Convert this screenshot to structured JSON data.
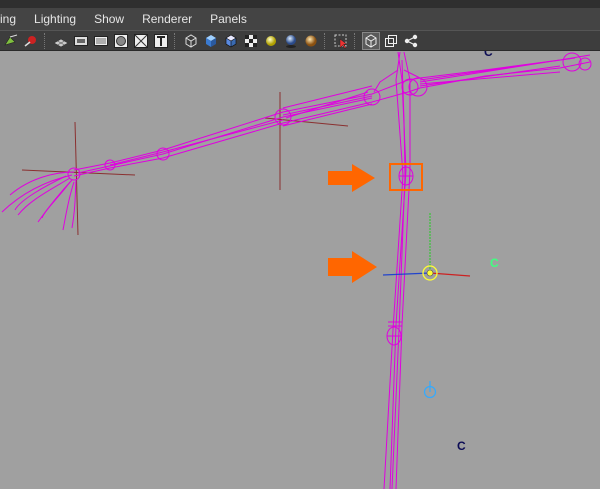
{
  "menubar": {
    "items": [
      "ing",
      "Lighting",
      "Show",
      "Renderer",
      "Panels"
    ]
  },
  "toolbar": {
    "icons": [
      "camera-select-icon",
      "camera-attributes-icon",
      "separator",
      "grid-icon",
      "film-gate-icon",
      "resolution-gate-icon",
      "gate-mask-icon",
      "field-chart-icon",
      "title-safe-icon",
      "separator",
      "wireframe-icon",
      "smooth-shade-icon",
      "wireframe-on-shaded-icon",
      "textured-icon",
      "default-light-icon",
      "shadows-icon",
      "high-quality-icon",
      "separator",
      "isolate-select-icon",
      "separator",
      "xray-icon",
      "xray-joints-icon",
      "node-graph-icon"
    ]
  },
  "viewport": {
    "labels": [
      {
        "id": "c-label-top",
        "text": "C",
        "color": "#0c0c55"
      },
      {
        "id": "c-label-green",
        "text": "C",
        "color": "#40ff80"
      },
      {
        "id": "c-label-bottom",
        "text": "C",
        "color": "#0c0c55"
      }
    ],
    "colors": {
      "skeleton": "#e000e0",
      "annotation_arrow": "#ff6600",
      "axis_x": "#cc2222",
      "axis_y": "#22cc22",
      "axis_z": "#2244cc",
      "manipulator": "#ffff33",
      "locator": "#33aaff"
    }
  }
}
